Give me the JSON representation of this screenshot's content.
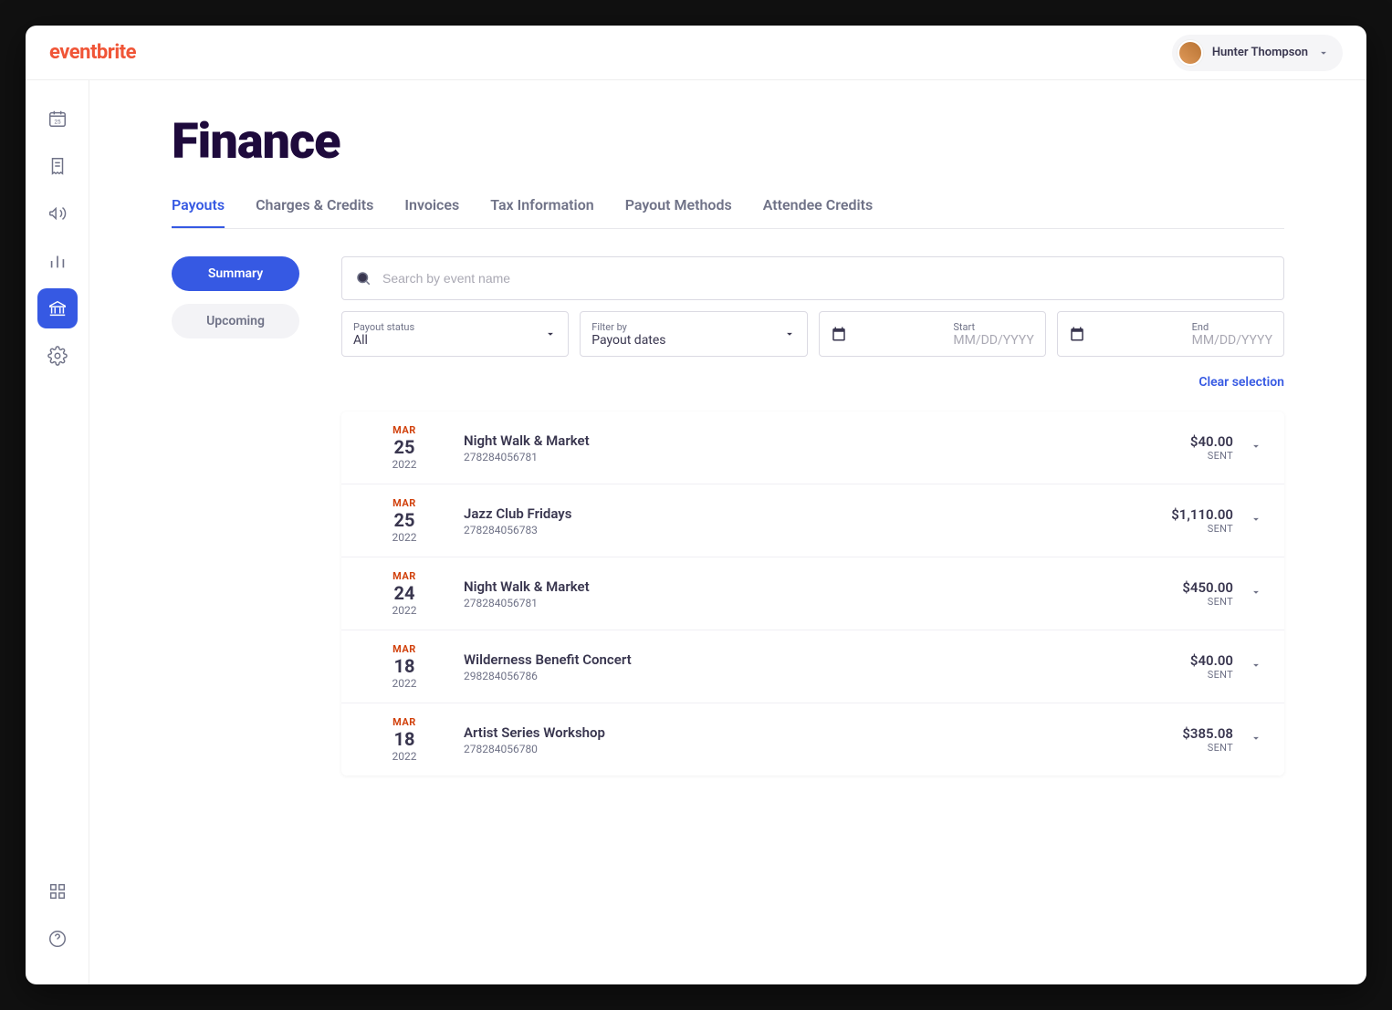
{
  "brand": "eventbrite",
  "user": {
    "name": "Hunter Thompson"
  },
  "page": {
    "title": "Finance"
  },
  "tabs": [
    {
      "label": "Payouts",
      "active": true
    },
    {
      "label": "Charges & Credits"
    },
    {
      "label": "Invoices"
    },
    {
      "label": "Tax Information"
    },
    {
      "label": "Payout Methods"
    },
    {
      "label": "Attendee Credits"
    }
  ],
  "sidetabs": {
    "summary": "Summary",
    "upcoming": "Upcoming"
  },
  "search": {
    "placeholder": "Search by event name"
  },
  "filters": {
    "status": {
      "label": "Payout status",
      "value": "All"
    },
    "filterby": {
      "label": "Filter by",
      "value": "Payout dates"
    },
    "start": {
      "label": "Start",
      "placeholder": "MM/DD/YYYY"
    },
    "end": {
      "label": "End",
      "placeholder": "MM/DD/YYYY"
    }
  },
  "clear_label": "Clear selection",
  "payouts": [
    {
      "month": "MAR",
      "day": "25",
      "year": "2022",
      "event": "Night Walk & Market",
      "id": "278284056781",
      "amount": "$40.00",
      "status": "SENT"
    },
    {
      "month": "MAR",
      "day": "25",
      "year": "2022",
      "event": "Jazz Club Fridays",
      "id": "278284056783",
      "amount": "$1,110.00",
      "status": "SENT"
    },
    {
      "month": "MAR",
      "day": "24",
      "year": "2022",
      "event": "Night Walk & Market",
      "id": "278284056781",
      "amount": "$450.00",
      "status": "SENT"
    },
    {
      "month": "MAR",
      "day": "18",
      "year": "2022",
      "event": "Wilderness Benefit Concert",
      "id": "298284056786",
      "amount": "$40.00",
      "status": "SENT"
    },
    {
      "month": "MAR",
      "day": "18",
      "year": "2022",
      "event": "Artist Series Workshop",
      "id": "278284056780",
      "amount": "$385.08",
      "status": "SENT"
    }
  ]
}
